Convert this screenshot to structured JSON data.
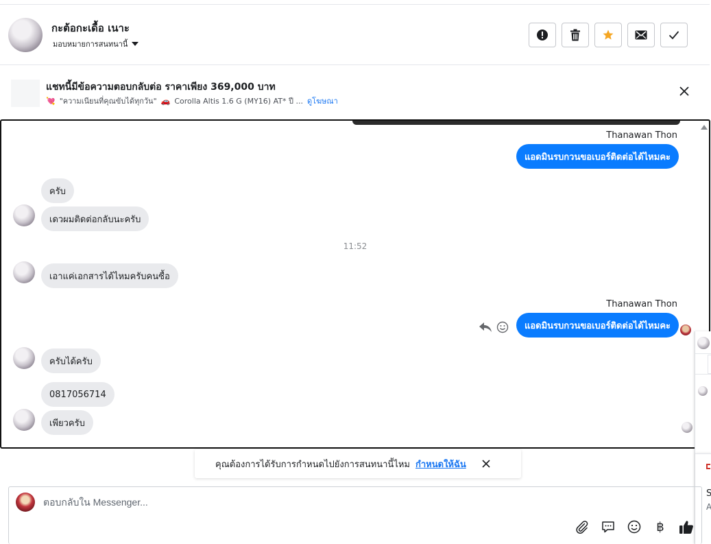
{
  "header": {
    "contact_name": "กะต้อกะเดื้อ เนาะ",
    "assign_label": "มอบหมายการสนทนานี้",
    "actions": [
      "spam-icon",
      "trash-icon",
      "star-icon",
      "envelope-icon",
      "check-icon"
    ],
    "star_color": "#f5a623"
  },
  "ad": {
    "title": "แชทนี้มีข้อความตอบกลับต่อ ราคาเพียง 369,000 บาท",
    "subtitle_heart": "💘",
    "subtitle_quote": "\"ความเนียนที่คุณขับได้ทุกวัน\"",
    "subtitle_car_icon": "🚗",
    "subtitle_model": "Corolla Altis 1.6 G (MY16) AT* ปี ...",
    "link": "ดูโฆษณา"
  },
  "chat": {
    "messages": [
      {
        "dir": "out",
        "sender": "Thanawan Thon",
        "text": "แอดมินรบกวนขอเบอร์ติดต่อได้ไหมคะ"
      },
      {
        "dir": "in",
        "text": "ครับ"
      },
      {
        "dir": "in",
        "text": "เดวผมติดต่อกลับนะครับ"
      },
      {
        "type": "time",
        "text": "11:52"
      },
      {
        "dir": "in",
        "text": "เอาแค่เอกสารได้ไหมครับคนซื้อ"
      },
      {
        "dir": "out",
        "sender": "Thanawan Thon",
        "text": "แอดมินรบกวนขอเบอร์ติดต่อได้ไหมคะ"
      },
      {
        "dir": "in",
        "text": "ครับได้ครับ"
      },
      {
        "dir": "in",
        "text": "0817056714"
      },
      {
        "dir": "in",
        "text": "เพียวครับ"
      }
    ],
    "bubble_out_color": "#0a7cff",
    "bubble_in_color": "#e9eaed"
  },
  "side_panel": {
    "letter_s": "S",
    "letter_a": "A"
  },
  "toast": {
    "text": "คุณต้องการได้รับการกำหนดไปยังการสนทนานี้ไหม",
    "link": "กำหนดให้ฉัน"
  },
  "composer": {
    "placeholder": "ตอบกลับใน Messenger...",
    "tools": [
      "paperclip-icon",
      "saved-reply-icon",
      "emoji-icon",
      "baht-icon",
      "thumbs-up-icon"
    ],
    "baht_symbol": "฿"
  }
}
